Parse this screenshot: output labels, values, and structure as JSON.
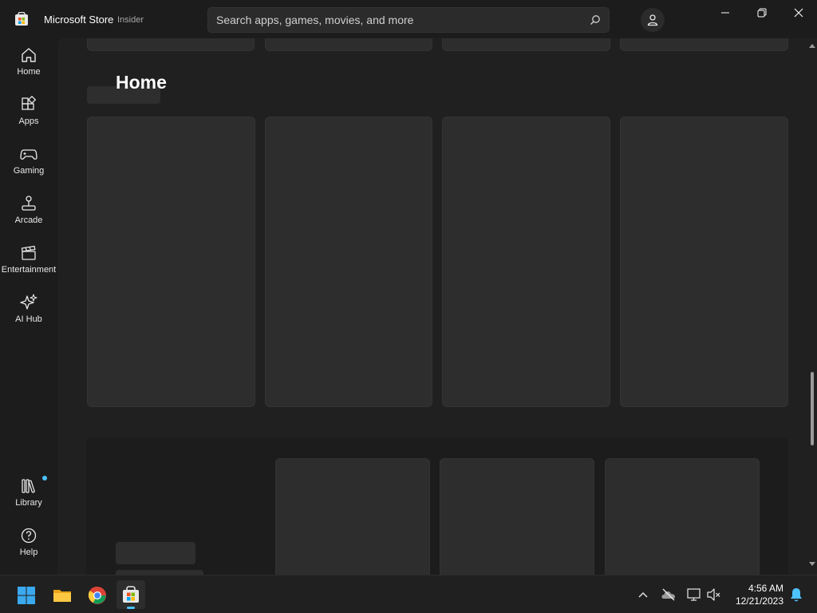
{
  "titlebar": {
    "app_name": "Microsoft Store",
    "channel": "Insider",
    "search_placeholder": "Search apps, games, movies, and more"
  },
  "window_controls": {
    "minimize": "minimize-icon",
    "maximize": "restore-icon",
    "close": "close-icon"
  },
  "sidebar": {
    "items": [
      {
        "label": "Home",
        "icon": "home-icon"
      },
      {
        "label": "Apps",
        "icon": "apps-icon"
      },
      {
        "label": "Gaming",
        "icon": "gamepad-icon"
      },
      {
        "label": "Arcade",
        "icon": "joystick-icon"
      },
      {
        "label": "Entertainment",
        "icon": "clapperboard-icon"
      },
      {
        "label": "AI Hub",
        "icon": "sparkle-icon"
      }
    ],
    "bottom_items": [
      {
        "label": "Library",
        "icon": "library-icon",
        "has_badge": true
      },
      {
        "label": "Help",
        "icon": "help-icon"
      }
    ]
  },
  "main": {
    "page_title": "Home"
  },
  "taskbar": {
    "apps": [
      {
        "name": "Start",
        "icon": "windows-start-icon"
      },
      {
        "name": "File Explorer",
        "icon": "folder-icon"
      },
      {
        "name": "Google Chrome",
        "icon": "chrome-icon"
      },
      {
        "name": "Microsoft Store",
        "icon": "store-icon",
        "active": true
      }
    ],
    "tray": [
      "chevron-up-icon",
      "onedrive-offline-icon",
      "network-icon",
      "volume-muted-icon"
    ],
    "time": "4:56 AM",
    "date": "12/21/2023",
    "notification_icon": "bell-icon"
  },
  "colors": {
    "background": "#1c1c1c",
    "content": "#202020",
    "skeleton": "#2d2d2d",
    "accent": "#4cc2ff"
  }
}
